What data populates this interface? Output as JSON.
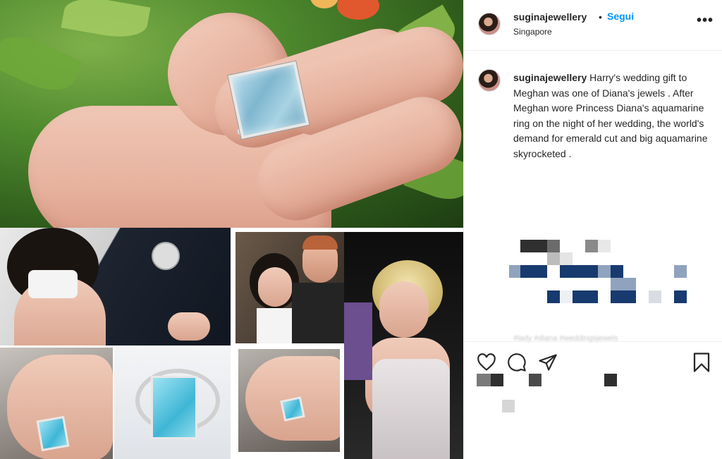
{
  "post": {
    "username": "suginajewellery",
    "separator": "•",
    "follow_label": "Segui",
    "location": "Singapore",
    "more_label": "•••",
    "caption_username": "suginajewellery",
    "caption_text": "Harry's wedding gift to Meghan was one of Diana's jewels . After Meghan wore Princess Diana's aquamarine ring on the night of her wedding, the world's demand for emerald cut and big aquamarine skyrocketed .",
    "hashtags_hint": "#lady #diana #weddingsjewels"
  },
  "icons": {
    "like": "heart-icon",
    "comment": "comment-icon",
    "share": "paper-plane-icon",
    "save": "bookmark-icon"
  },
  "colors": {
    "follow_blue": "#0095f6",
    "text": "#262626",
    "divider": "#efefef",
    "pixel_navy": "#173a6f",
    "pixel_dark": "#2f2f2f"
  }
}
